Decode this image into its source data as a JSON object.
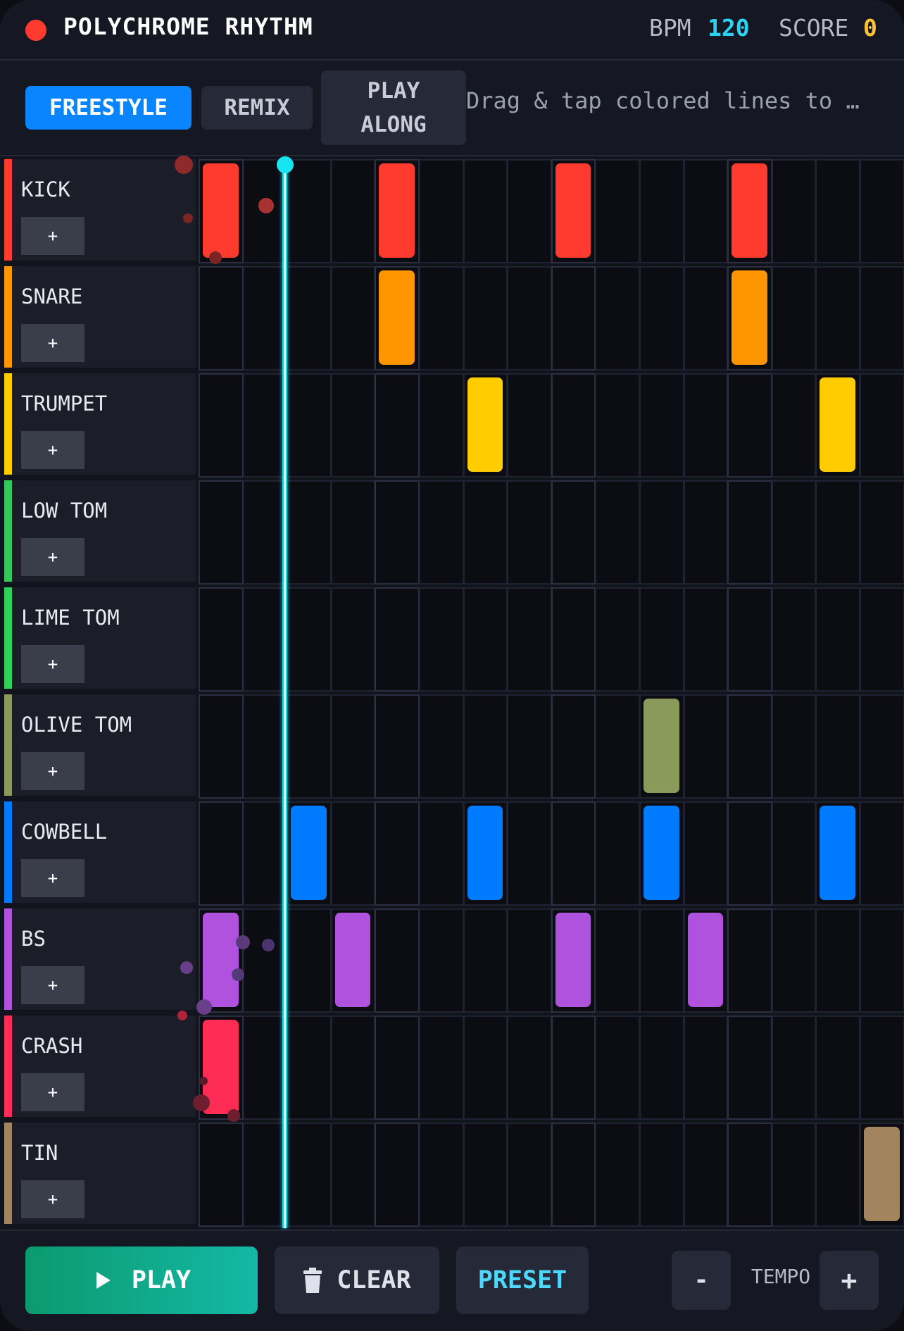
{
  "header": {
    "title": "POLYCHROME RHYTHM",
    "bpm_label": "BPM",
    "bpm_value": "120",
    "score_label": "SCORE",
    "score_value": "0"
  },
  "modes": {
    "freestyle": "FREESTYLE",
    "remix": "REMIX",
    "play_along_line1": "PLAY",
    "play_along_line2": "ALONG",
    "active": "FREESTYLE",
    "hint": "Drag & tap colored lines to …"
  },
  "steps": 16,
  "playhead_step": 2,
  "tracks": [
    {
      "name": "KICK",
      "add_label": "+",
      "color": "#ff3b30",
      "notes": [
        0,
        4,
        8,
        12
      ]
    },
    {
      "name": "SNARE",
      "add_label": "+",
      "color": "#ff9500",
      "notes": [
        4,
        12
      ]
    },
    {
      "name": "TRUMPET",
      "add_label": "+",
      "color": "#ffcc00",
      "notes": [
        6,
        14
      ]
    },
    {
      "name": "LOW TOM",
      "add_label": "+",
      "color": "#34c759",
      "notes": []
    },
    {
      "name": "LIME TOM",
      "add_label": "+",
      "color": "#30d158",
      "notes": []
    },
    {
      "name": "OLIVE TOM",
      "add_label": "+",
      "color": "#8a9a5b",
      "notes": [
        10
      ]
    },
    {
      "name": "COWBELL",
      "add_label": "+",
      "color": "#007aff",
      "notes": [
        2,
        6,
        10,
        14
      ]
    },
    {
      "name": "BS",
      "add_label": "+",
      "color": "#af52de",
      "notes": [
        0,
        3,
        8,
        11
      ]
    },
    {
      "name": "CRASH",
      "add_label": "+",
      "color": "#ff2d55",
      "notes": [
        0
      ]
    },
    {
      "name": "TIN",
      "add_label": "+",
      "color": "#a2845e",
      "notes": [
        15
      ]
    }
  ],
  "footer": {
    "play_icon": "play-icon",
    "play_label": "PLAY",
    "clear_icon": "trash-icon",
    "clear_label": "CLEAR",
    "preset_label": "PRESET",
    "tempo_minus": "-",
    "tempo_label": "TEMPO",
    "tempo_plus": "+"
  },
  "colors": {
    "accent_blue": "#0a84ff",
    "play_green": "#0fa97f",
    "preset_cyan": "#4fd7ff",
    "bpm_cyan": "#2ad4f0",
    "score_gold": "#ffc233",
    "playhead": "#16e4ef"
  }
}
